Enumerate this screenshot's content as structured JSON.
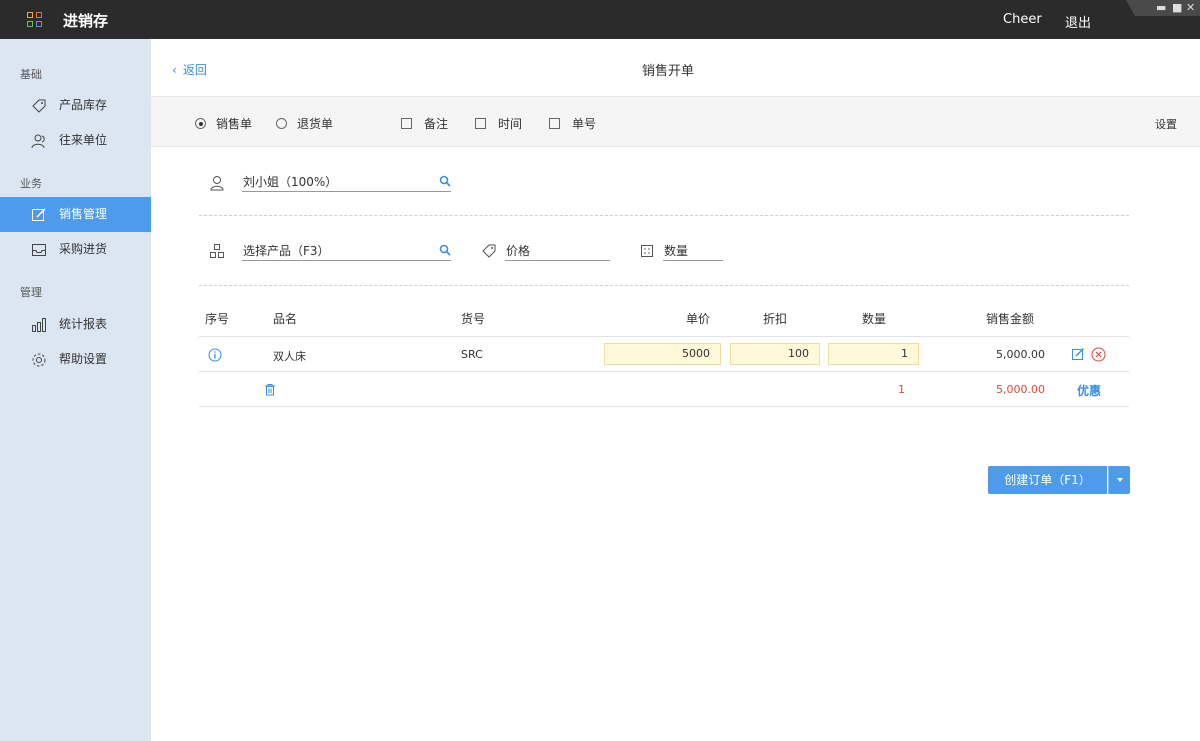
{
  "app": {
    "title": "进销存",
    "user": "Cheer",
    "logout": "退出"
  },
  "sidebar": {
    "groups": [
      "基础",
      "业务",
      "管理"
    ],
    "items": [
      {
        "label": "产品库存",
        "icon": "tag-icon"
      },
      {
        "label": "往来单位",
        "icon": "contacts-icon"
      },
      {
        "label": "销售管理",
        "icon": "edit-icon",
        "active": true
      },
      {
        "label": "采购进货",
        "icon": "inbox-icon"
      },
      {
        "label": "统计报表",
        "icon": "bar-chart-icon"
      },
      {
        "label": "帮助设置",
        "icon": "gear-icon"
      }
    ]
  },
  "header": {
    "back": "返回",
    "title": "销售开单"
  },
  "options": {
    "sale": "销售单",
    "return": "退货单",
    "remark": "备注",
    "time": "时间",
    "number": "单号",
    "settings": "设置"
  },
  "customer": {
    "value": "刘小姐（100%）"
  },
  "product": {
    "placeholder": "选择产品（F3）",
    "price": "价格",
    "qty": "数量"
  },
  "table": {
    "headers": [
      "序号",
      "品名",
      "货号",
      "单价",
      "折扣",
      "数量",
      "销售金额"
    ],
    "rows": [
      {
        "name": "双人床",
        "sku": "SRC",
        "price": "5000",
        "discount": "100",
        "qty": "1",
        "amount": "5,000.00"
      }
    ],
    "total": {
      "qty": "1",
      "amount": "5,000.00",
      "promo": "优惠"
    }
  },
  "actions": {
    "create": "创建订单（F1）"
  },
  "colors": {
    "accent": "#4d9bea",
    "sidebar_bg": "#dce6f2",
    "titlebar_bg": "#2b2b2b",
    "total_red": "#e04a3a",
    "input_bg": "#fff8d9"
  }
}
